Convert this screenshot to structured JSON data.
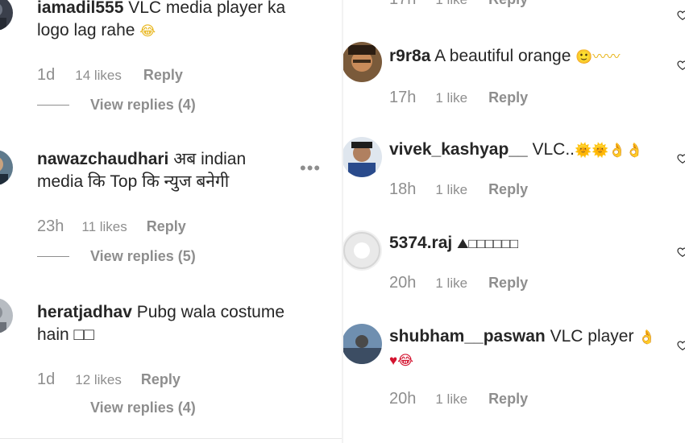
{
  "left": {
    "comments": [
      {
        "username": "iamadil555",
        "text_line1": "VLC media player ka",
        "text_line2": "logo lag rahe",
        "emoji": "😂",
        "time": "1d",
        "likes": "14 likes",
        "reply": "Reply",
        "view_replies": "View replies (4)"
      },
      {
        "username": "nawazchaudhari",
        "text_line1": "अब indian",
        "text_line2": "media कि Top कि न्युज बनेगी",
        "time": "23h",
        "likes": "11 likes",
        "reply": "Reply",
        "view_replies": "View replies (5)",
        "more": "•••"
      },
      {
        "username": "heratjadhav",
        "text_line1": "Pubg wala costume",
        "text_line2": "hain □□",
        "time": "1d",
        "likes": "12 likes",
        "reply": "Reply",
        "view_replies": "View replies (4)"
      }
    ]
  },
  "right": {
    "top_partial": {
      "time": "17h",
      "likes": "1 like",
      "reply": "Reply"
    },
    "comments": [
      {
        "username": "r9r8a",
        "text": "A beautiful orange",
        "emoji": "🙂〰〰",
        "time": "17h",
        "likes": "1 like",
        "reply": "Reply"
      },
      {
        "username": "vivek_kashyap__",
        "text": "VLC..",
        "emoji": "🌞🌞👌👌",
        "time": "18h",
        "likes": "1 like",
        "reply": "Reply"
      },
      {
        "username": "5374.raj",
        "text": "",
        "emoji": "⛰□□□□□□",
        "time": "20h",
        "likes": "1 like",
        "reply": "Reply"
      },
      {
        "username": "shubham__paswan",
        "text": "VLC player",
        "emoji": "👌",
        "emoji_line2": "♥😂",
        "time": "20h",
        "likes": "1 like",
        "reply": "Reply"
      }
    ]
  },
  "colors": {
    "text": "#262626",
    "muted": "#8e8e8e",
    "background": "#ffffff"
  },
  "icons": [
    "avatar",
    "more-options-icon",
    "heart-icon"
  ]
}
